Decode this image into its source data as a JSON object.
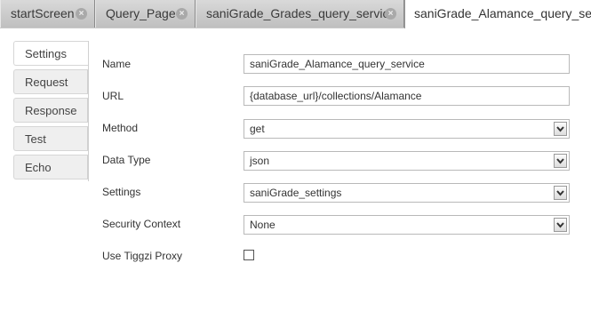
{
  "tabs": [
    {
      "label": "startScreen"
    },
    {
      "label": "Query_Page"
    },
    {
      "label": "saniGrade_Grades_query_service"
    },
    {
      "label": "saniGrade_Alamance_query_service"
    }
  ],
  "side_tabs": [
    {
      "label": "Settings"
    },
    {
      "label": "Request"
    },
    {
      "label": "Response"
    },
    {
      "label": "Test"
    },
    {
      "label": "Echo"
    }
  ],
  "form": {
    "name_label": "Name",
    "name_value": "saniGrade_Alamance_query_service",
    "url_label": "URL",
    "url_value": "{database_url}/collections/Alamance",
    "method_label": "Method",
    "method_value": "get",
    "datatype_label": "Data Type",
    "datatype_value": "json",
    "settings_label": "Settings",
    "settings_value": "saniGrade_settings",
    "security_label": "Security Context",
    "security_value": "None",
    "proxy_label": "Use Tiggzi Proxy",
    "proxy_checked": false
  }
}
